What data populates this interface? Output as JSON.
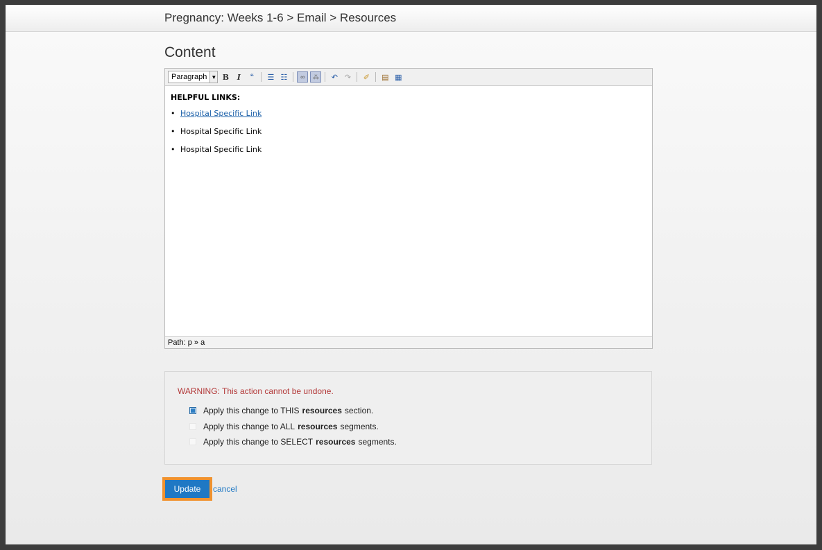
{
  "header": {
    "breadcrumb": "Pregnancy: Weeks 1-6 > Email > Resources"
  },
  "main": {
    "section_title": "Content",
    "editor": {
      "format_select": "Paragraph",
      "toolbar_icons": [
        "bold-icon",
        "italic-icon",
        "blockquote-icon",
        "bullet-list-icon",
        "numbered-list-icon",
        "link-icon",
        "unlink-icon",
        "undo-icon",
        "redo-icon",
        "cleanup-icon",
        "paste-text-icon",
        "paste-word-icon"
      ],
      "heading": "HELPFUL LINKS:",
      "links": [
        "Hospital Specific Link",
        "Hospital Specific Link",
        "Hospital Specific Link"
      ],
      "path": "Path: p » a"
    },
    "warning": {
      "text": "WARNING: This action cannot be undone.",
      "options": [
        {
          "pre": "Apply this change to THIS",
          "bold": "resources",
          "post": "section.",
          "checked": true
        },
        {
          "pre": "Apply this change to ALL",
          "bold": "resources",
          "post": "segments.",
          "checked": false
        },
        {
          "pre": "Apply this change to SELECT",
          "bold": "resources",
          "post": "segments.",
          "checked": false
        }
      ]
    },
    "actions": {
      "update_label": "Update",
      "cancel_label": "cancel"
    }
  },
  "colors": {
    "accent": "#1f78c4",
    "highlight": "#f0922f",
    "warning": "#b33a3a"
  }
}
